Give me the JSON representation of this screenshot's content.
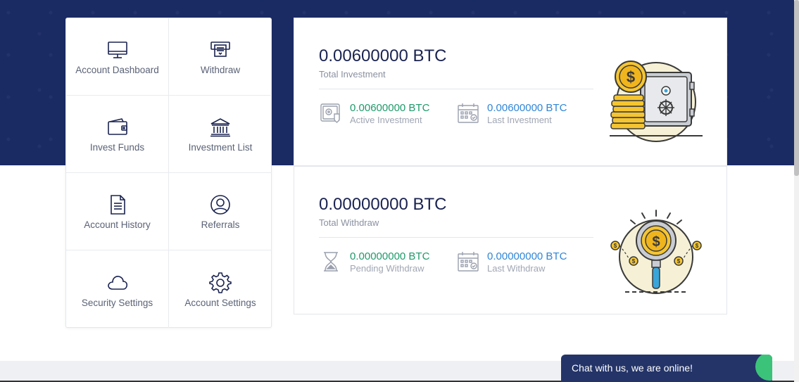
{
  "menu": {
    "items": [
      {
        "label": "Account Dashboard",
        "icon": "monitor-icon"
      },
      {
        "label": "Withdraw",
        "icon": "atm-icon"
      },
      {
        "label": "Invest Funds",
        "icon": "wallet-icon"
      },
      {
        "label": "Investment List",
        "icon": "bank-icon"
      },
      {
        "label": "Account History",
        "icon": "document-icon"
      },
      {
        "label": "Referrals",
        "icon": "user-circle-icon"
      },
      {
        "label": "Security Settings",
        "icon": "cloud-icon"
      },
      {
        "label": "Account Settings",
        "icon": "gear-icon"
      }
    ]
  },
  "investment": {
    "amount": "0.00600000 BTC",
    "label": "Total Investment",
    "active_value": "0.00600000 BTC",
    "active_label": "Active Investment",
    "last_value": "0.00600000 BTC",
    "last_label": "Last Investment"
  },
  "withdraw": {
    "amount": "0.00000000 BTC",
    "label": "Total Withdraw",
    "pending_value": "0.00000000 BTC",
    "pending_label": "Pending Withdraw",
    "last_value": "0.00000000 BTC",
    "last_label": "Last Withdraw"
  },
  "chat": {
    "text": "Chat with us, we are online!"
  },
  "colors": {
    "navy": "#1a2a63",
    "green": "#1e9a6a",
    "blue": "#2f86d6",
    "chat_bg": "#243468",
    "online": "#3cc37a"
  }
}
